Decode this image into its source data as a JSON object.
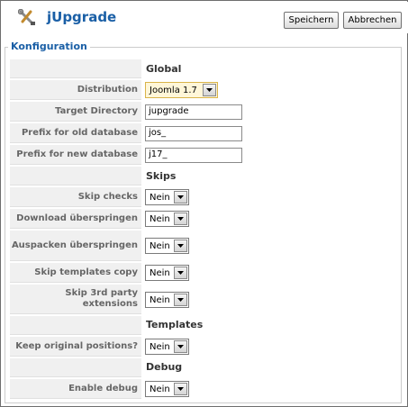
{
  "header": {
    "title": "jUpgrade",
    "save_label": "Speichern",
    "cancel_label": "Abbrechen"
  },
  "config": {
    "legend": "Konfiguration",
    "sections": {
      "global": "Global",
      "skips": "Skips",
      "templates": "Templates",
      "debug": "Debug"
    },
    "fields": {
      "distribution": {
        "label": "Distribution",
        "value": "Joomla 1.7"
      },
      "target_directory": {
        "label": "Target Directory",
        "value": "jupgrade"
      },
      "prefix_old": {
        "label": "Prefix for old database",
        "value": "jos_"
      },
      "prefix_new": {
        "label": "Prefix for new database",
        "value": "j17_"
      },
      "skip_checks": {
        "label": "Skip checks",
        "value": "Nein"
      },
      "download_skip": {
        "label": "Download überspringen",
        "value": "Nein"
      },
      "unpack_skip": {
        "label": "Auspacken überspringen",
        "value": "Nein"
      },
      "skip_templates": {
        "label": "Skip templates copy",
        "value": "Nein"
      },
      "skip_3rdparty": {
        "label": "Skip 3rd party extensions",
        "value": "Nein"
      },
      "keep_positions": {
        "label": "Keep original positions?",
        "value": "Nein"
      },
      "enable_debug": {
        "label": "Enable debug",
        "value": "Nein"
      }
    }
  },
  "colors": {
    "title_blue": "#1a5fa6",
    "label_bg": "#f0f0f0",
    "highlight_select": "#fff6d8"
  }
}
